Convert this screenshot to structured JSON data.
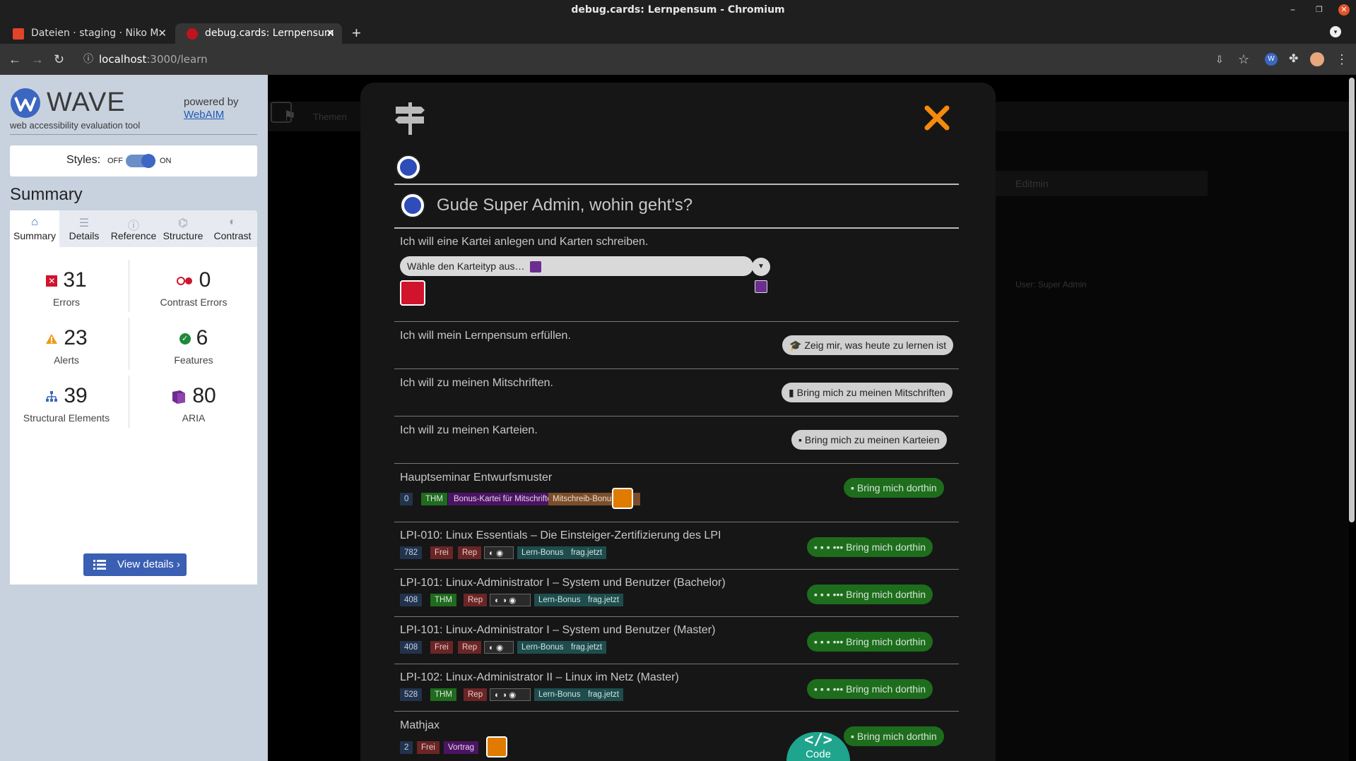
{
  "window": {
    "title": "debug.cards: Lernpensum - Chromium"
  },
  "tabs": [
    {
      "label": "Dateien · staging · Niko M",
      "active": false
    },
    {
      "label": "debug.cards: Lernpensum",
      "active": true
    }
  ],
  "address": {
    "host": "localhost",
    "path": ":3000/learn"
  },
  "wave": {
    "name": "WAVE",
    "subtitle": "web accessibility evaluation tool",
    "powered_by": "powered by",
    "webaim": "WebAIM",
    "styles_label": "Styles:",
    "off": "OFF",
    "on": "ON",
    "summary_heading": "Summary",
    "tabs": [
      "Summary",
      "Details",
      "Reference",
      "Structure",
      "Contrast"
    ],
    "stats": {
      "errors": {
        "value": "31",
        "label": "Errors"
      },
      "contrast": {
        "value": "0",
        "label": "Contrast Errors"
      },
      "alerts": {
        "value": "23",
        "label": "Alerts"
      },
      "features": {
        "value": "6",
        "label": "Features"
      },
      "structural": {
        "value": "39",
        "label": "Structural Elements"
      },
      "aria": {
        "value": "80",
        "label": "ARIA"
      }
    },
    "view_details": "View details ›"
  },
  "background": {
    "themen": "Themen",
    "edit": "Editmin",
    "user": "User: Super Admin"
  },
  "modal": {
    "greeting": "Gude Super Admin, wohin geht's?",
    "q_create": "Ich will eine Kartei anlegen und Karten schreiben.",
    "select_placeholder": "Wähle den Karteityp aus…",
    "q_learn": "Ich will mein Lernpensum erfüllen.",
    "btn_learn": "Zeig mir, was heute zu lernen ist",
    "q_notes": "Ich will zu meinen Mitschriften.",
    "btn_notes": "Bring mich zu meinen Mitschriften",
    "q_decks": "Ich will zu meinen Karteien.",
    "btn_decks": "Bring mich zu meinen Karteien",
    "go": "Bring mich dorthin",
    "go_more": "••• Bring mich dorthin",
    "decks": [
      {
        "title": "Hauptseminar Entwurfsmuster",
        "count": "0",
        "badges": [
          "THM",
          "Bonus-Kartei für Mitschriften",
          "Mitschreib-Bonus"
        ]
      },
      {
        "title": "LPI-010: Linux Essentials – Die Einsteiger-Zertifizierung des LPI",
        "count": "782",
        "badges": [
          "Frei",
          "Rep",
          "Lern-Bonus",
          "frag.jetzt"
        ]
      },
      {
        "title": "LPI-101: Linux-Administrator I – System und Benutzer (Bachelor)",
        "count": "408",
        "badges": [
          "THM",
          "Rep",
          "Lern-Bonus",
          "frag.jetzt"
        ]
      },
      {
        "title": "LPI-101: Linux-Administrator I – System und Benutzer (Master)",
        "count": "408",
        "badges": [
          "Frei",
          "Rep",
          "Lern-Bonus",
          "frag.jetzt"
        ]
      },
      {
        "title": "LPI-102: Linux-Administrator II – Linux im Netz (Master)",
        "count": "528",
        "badges": [
          "THM",
          "Rep",
          "Lern-Bonus",
          "frag.jetzt"
        ]
      },
      {
        "title": "Mathjax",
        "count": "2",
        "badges": [
          "Frei",
          "Vortrag"
        ]
      }
    ],
    "code_label": "Code"
  }
}
